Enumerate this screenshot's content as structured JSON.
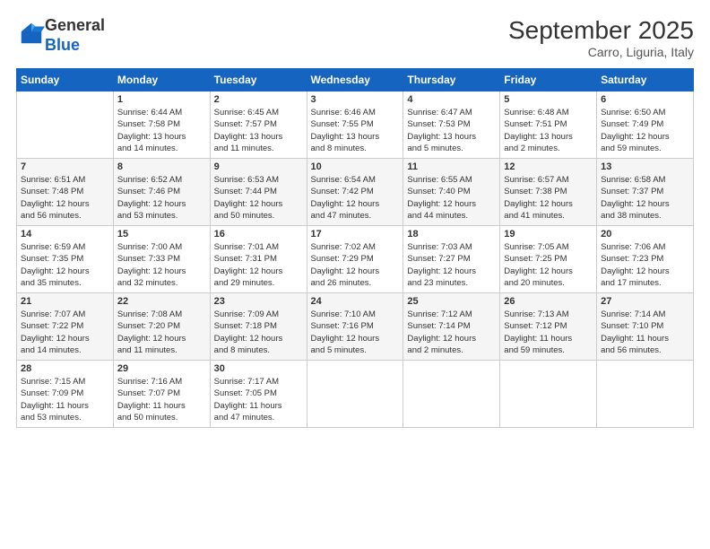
{
  "header": {
    "logo_line1": "General",
    "logo_line2": "Blue",
    "month_year": "September 2025",
    "location": "Carro, Liguria, Italy"
  },
  "weekdays": [
    "Sunday",
    "Monday",
    "Tuesday",
    "Wednesday",
    "Thursday",
    "Friday",
    "Saturday"
  ],
  "weeks": [
    [
      {
        "date": "",
        "info": ""
      },
      {
        "date": "1",
        "info": "Sunrise: 6:44 AM\nSunset: 7:58 PM\nDaylight: 13 hours\nand 14 minutes."
      },
      {
        "date": "2",
        "info": "Sunrise: 6:45 AM\nSunset: 7:57 PM\nDaylight: 13 hours\nand 11 minutes."
      },
      {
        "date": "3",
        "info": "Sunrise: 6:46 AM\nSunset: 7:55 PM\nDaylight: 13 hours\nand 8 minutes."
      },
      {
        "date": "4",
        "info": "Sunrise: 6:47 AM\nSunset: 7:53 PM\nDaylight: 13 hours\nand 5 minutes."
      },
      {
        "date": "5",
        "info": "Sunrise: 6:48 AM\nSunset: 7:51 PM\nDaylight: 13 hours\nand 2 minutes."
      },
      {
        "date": "6",
        "info": "Sunrise: 6:50 AM\nSunset: 7:49 PM\nDaylight: 12 hours\nand 59 minutes."
      }
    ],
    [
      {
        "date": "7",
        "info": "Sunrise: 6:51 AM\nSunset: 7:48 PM\nDaylight: 12 hours\nand 56 minutes."
      },
      {
        "date": "8",
        "info": "Sunrise: 6:52 AM\nSunset: 7:46 PM\nDaylight: 12 hours\nand 53 minutes."
      },
      {
        "date": "9",
        "info": "Sunrise: 6:53 AM\nSunset: 7:44 PM\nDaylight: 12 hours\nand 50 minutes."
      },
      {
        "date": "10",
        "info": "Sunrise: 6:54 AM\nSunset: 7:42 PM\nDaylight: 12 hours\nand 47 minutes."
      },
      {
        "date": "11",
        "info": "Sunrise: 6:55 AM\nSunset: 7:40 PM\nDaylight: 12 hours\nand 44 minutes."
      },
      {
        "date": "12",
        "info": "Sunrise: 6:57 AM\nSunset: 7:38 PM\nDaylight: 12 hours\nand 41 minutes."
      },
      {
        "date": "13",
        "info": "Sunrise: 6:58 AM\nSunset: 7:37 PM\nDaylight: 12 hours\nand 38 minutes."
      }
    ],
    [
      {
        "date": "14",
        "info": "Sunrise: 6:59 AM\nSunset: 7:35 PM\nDaylight: 12 hours\nand 35 minutes."
      },
      {
        "date": "15",
        "info": "Sunrise: 7:00 AM\nSunset: 7:33 PM\nDaylight: 12 hours\nand 32 minutes."
      },
      {
        "date": "16",
        "info": "Sunrise: 7:01 AM\nSunset: 7:31 PM\nDaylight: 12 hours\nand 29 minutes."
      },
      {
        "date": "17",
        "info": "Sunrise: 7:02 AM\nSunset: 7:29 PM\nDaylight: 12 hours\nand 26 minutes."
      },
      {
        "date": "18",
        "info": "Sunrise: 7:03 AM\nSunset: 7:27 PM\nDaylight: 12 hours\nand 23 minutes."
      },
      {
        "date": "19",
        "info": "Sunrise: 7:05 AM\nSunset: 7:25 PM\nDaylight: 12 hours\nand 20 minutes."
      },
      {
        "date": "20",
        "info": "Sunrise: 7:06 AM\nSunset: 7:23 PM\nDaylight: 12 hours\nand 17 minutes."
      }
    ],
    [
      {
        "date": "21",
        "info": "Sunrise: 7:07 AM\nSunset: 7:22 PM\nDaylight: 12 hours\nand 14 minutes."
      },
      {
        "date": "22",
        "info": "Sunrise: 7:08 AM\nSunset: 7:20 PM\nDaylight: 12 hours\nand 11 minutes."
      },
      {
        "date": "23",
        "info": "Sunrise: 7:09 AM\nSunset: 7:18 PM\nDaylight: 12 hours\nand 8 minutes."
      },
      {
        "date": "24",
        "info": "Sunrise: 7:10 AM\nSunset: 7:16 PM\nDaylight: 12 hours\nand 5 minutes."
      },
      {
        "date": "25",
        "info": "Sunrise: 7:12 AM\nSunset: 7:14 PM\nDaylight: 12 hours\nand 2 minutes."
      },
      {
        "date": "26",
        "info": "Sunrise: 7:13 AM\nSunset: 7:12 PM\nDaylight: 11 hours\nand 59 minutes."
      },
      {
        "date": "27",
        "info": "Sunrise: 7:14 AM\nSunset: 7:10 PM\nDaylight: 11 hours\nand 56 minutes."
      }
    ],
    [
      {
        "date": "28",
        "info": "Sunrise: 7:15 AM\nSunset: 7:09 PM\nDaylight: 11 hours\nand 53 minutes."
      },
      {
        "date": "29",
        "info": "Sunrise: 7:16 AM\nSunset: 7:07 PM\nDaylight: 11 hours\nand 50 minutes."
      },
      {
        "date": "30",
        "info": "Sunrise: 7:17 AM\nSunset: 7:05 PM\nDaylight: 11 hours\nand 47 minutes."
      },
      {
        "date": "",
        "info": ""
      },
      {
        "date": "",
        "info": ""
      },
      {
        "date": "",
        "info": ""
      },
      {
        "date": "",
        "info": ""
      }
    ]
  ]
}
